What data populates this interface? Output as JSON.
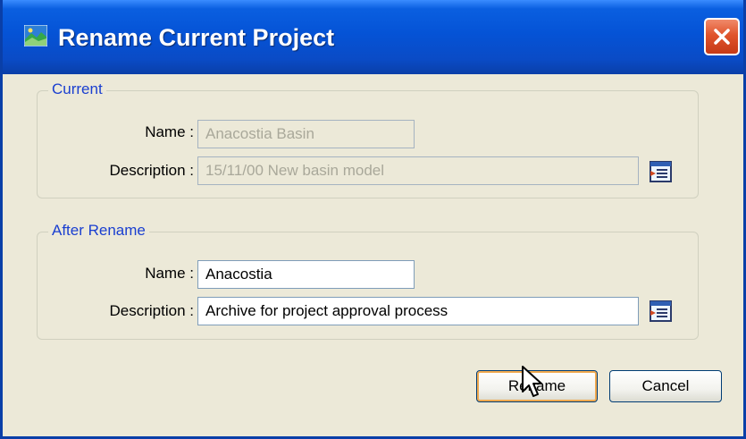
{
  "window": {
    "title": "Rename Current Project",
    "close_icon": "close-icon",
    "app_icon": "project-icon"
  },
  "current": {
    "legend": "Current",
    "name_label": "Name :",
    "name_value": "Anacostia Basin",
    "description_label": "Description :",
    "description_value": "15/11/00 New basin model",
    "edit_icon": "edit-description-icon"
  },
  "after_rename": {
    "legend": "After Rename",
    "name_label": "Name :",
    "name_value": "Anacostia",
    "description_label": "Description :",
    "description_value": "Archive for project approval process",
    "edit_icon": "edit-description-icon"
  },
  "buttons": {
    "rename": "Rename",
    "cancel": "Cancel"
  },
  "colors": {
    "titlebar": "#0553d6",
    "legend_text": "#1a3fd0",
    "close_button": "#e0542c",
    "dialog_bg": "#ece9d8"
  }
}
